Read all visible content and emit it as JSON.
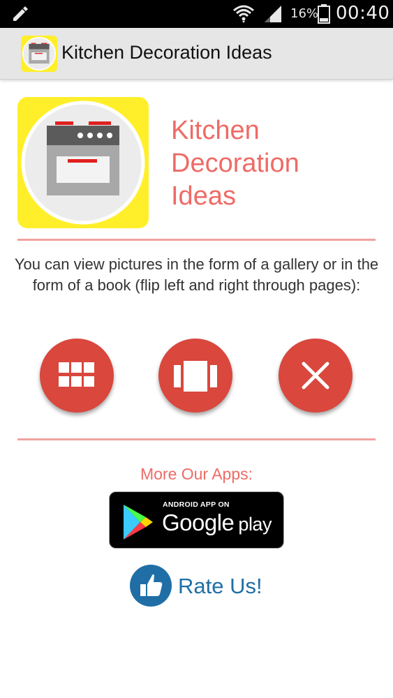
{
  "status_bar": {
    "battery_percent": "16%",
    "time": "00:40",
    "icons": [
      "pencil-icon",
      "wifi-icon",
      "signal-icon",
      "battery-icon"
    ]
  },
  "action_bar": {
    "title": "Kitchen Decoration Ideas",
    "icon": "stove-icon"
  },
  "hero": {
    "title_lines": [
      "Kitchen",
      "Decoration",
      "Ideas"
    ],
    "icon": "stove-icon"
  },
  "description": "You can view pictures in the form of a gallery or in the form of a book (flip left and right through pages):",
  "actions": [
    {
      "name": "gallery-button",
      "icon": "grid-icon"
    },
    {
      "name": "book-button",
      "icon": "book-pages-icon"
    },
    {
      "name": "exit-button",
      "icon": "close-icon"
    }
  ],
  "more_apps": {
    "label": "More Our Apps:",
    "badge_small": "ANDROID APP ON",
    "badge_google": "Google",
    "badge_play": "play"
  },
  "rate": {
    "label": "Rate Us!",
    "icon": "thumbs-up-icon"
  },
  "colors": {
    "accent": "#ee6b66",
    "button": "#d9473d",
    "rate": "#1f6fa6",
    "icon_bg": "#ffef2a"
  }
}
